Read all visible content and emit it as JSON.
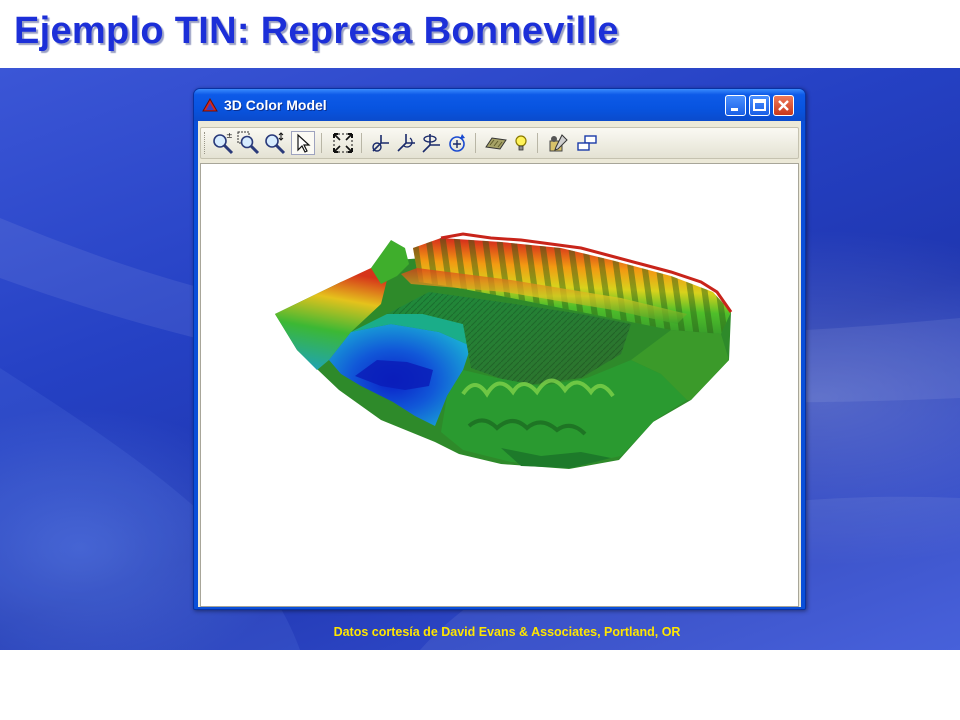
{
  "slide": {
    "title": "Ejemplo TIN: Represa Bonneville",
    "credit": "Datos cortesía de David Evans & Associates, Portland, OR"
  },
  "window": {
    "title": "3D Color Model",
    "controls": [
      "minimize",
      "maximize",
      "close"
    ]
  },
  "toolbar": {
    "tools": [
      "zoom-in-out-icon",
      "zoom-window-icon",
      "zoom-extents-icon",
      "select-pointer-icon",
      "fit-view-icon",
      "pan-icon",
      "rotate-icon",
      "tilt-icon",
      "orbit-icon",
      "texture-icon",
      "light-bulb-icon",
      "settings-icon",
      "view-layout-icon"
    ]
  },
  "model": {
    "type": "TIN surface (Bonneville dam)",
    "color_ramp": [
      "#0a1fc8",
      "#19a7e0",
      "#22c48a",
      "#3cb53a",
      "#9ed41a",
      "#f5d21a",
      "#f57a10",
      "#d8261a"
    ]
  }
}
